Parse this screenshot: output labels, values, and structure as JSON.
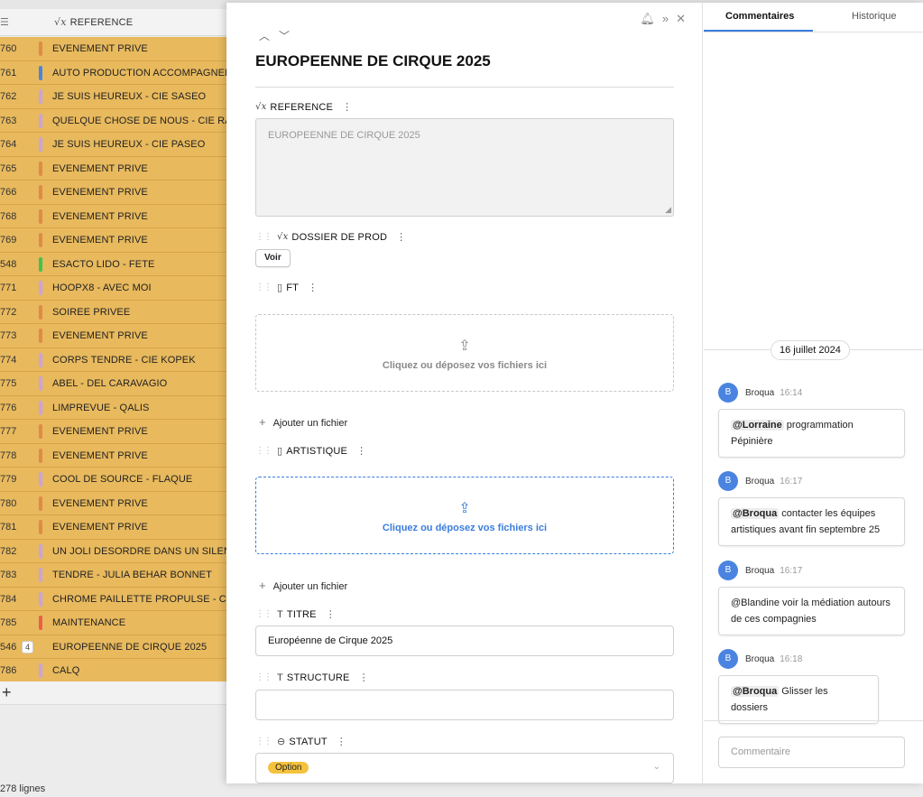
{
  "grid": {
    "header_label": "REFERENCE",
    "rows": [
      {
        "num": "760",
        "ref": "EVENEMENT PRIVE",
        "color": "#e08a4a"
      },
      {
        "num": "761",
        "ref": "AUTO PRODUCTION ACCOMPAGNEE",
        "color": "#4a84e0"
      },
      {
        "num": "762",
        "ref": "JE SUIS HEUREUX - CIE SASEO",
        "color": "#c9a3e0"
      },
      {
        "num": "763",
        "ref": "QUELQUE CHOSE DE NOUS - CIE RAMI",
        "color": "#c9a3e0"
      },
      {
        "num": "764",
        "ref": "JE SUIS HEUREUX - CIE PASEO",
        "color": "#c9a3e0"
      },
      {
        "num": "765",
        "ref": "EVENEMENT PRIVE",
        "color": "#e08a4a"
      },
      {
        "num": "766",
        "ref": "EVENEMENT PRIVE",
        "color": "#e08a4a"
      },
      {
        "num": "768",
        "ref": "EVENEMENT PRIVE",
        "color": "#e08a4a"
      },
      {
        "num": "769",
        "ref": "EVENEMENT PRIVE",
        "color": "#e08a4a"
      },
      {
        "num": "548",
        "ref": "ESACTO LIDO - FETE",
        "color": "#3cc452"
      },
      {
        "num": "771",
        "ref": "HOOPX8 - AVEC MOI",
        "color": "#c9a3e0"
      },
      {
        "num": "772",
        "ref": "SOIREE PRIVEE",
        "color": "#e08a4a"
      },
      {
        "num": "773",
        "ref": "EVENEMENT PRIVE",
        "color": "#e08a4a"
      },
      {
        "num": "774",
        "ref": "CORPS TENDRE - CIE KOPEK",
        "color": "#c9a3e0"
      },
      {
        "num": "775",
        "ref": "ABEL - DEL CARAVAGIO",
        "color": "#c9a3e0"
      },
      {
        "num": "776",
        "ref": "LIMPREVUE - QALIS",
        "color": "#c9a3e0"
      },
      {
        "num": "777",
        "ref": "EVENEMENT PRIVE",
        "color": "#e08a4a"
      },
      {
        "num": "778",
        "ref": "EVENEMENT PRIVE",
        "color": "#e08a4a"
      },
      {
        "num": "779",
        "ref": "COOL DE SOURCE - FLAQUE",
        "color": "#c9a3e0"
      },
      {
        "num": "780",
        "ref": "EVENEMENT PRIVE",
        "color": "#e08a4a"
      },
      {
        "num": "781",
        "ref": "EVENEMENT PRIVE",
        "color": "#e08a4a"
      },
      {
        "num": "782",
        "ref": "UN JOLI DESORDRE DANS UN SILENCE",
        "color": "#c9a3e0"
      },
      {
        "num": "783",
        "ref": "TENDRE - JULIA BEHAR BONNET",
        "color": "#c9a3e0"
      },
      {
        "num": "784",
        "ref": "CHROME PAILLETTE PROPULSE - CIRQ",
        "color": "#c9a3e0"
      },
      {
        "num": "785",
        "ref": "MAINTENANCE",
        "color": "#e8604a"
      },
      {
        "num": "546",
        "ref": "EUROPEENNE DE CIRQUE 2025",
        "color": "",
        "count": "4"
      },
      {
        "num": "786",
        "ref": "CALQ",
        "color": "#c9a3e0"
      }
    ],
    "footer": "278 lignes"
  },
  "detail": {
    "title": "EUROPEENNE DE CIRQUE 2025",
    "fields": {
      "reference": {
        "label": "REFERENCE",
        "value": "EUROPEENNE DE CIRQUE 2025"
      },
      "dossier": {
        "label": "DOSSIER DE PROD",
        "button": "Voir"
      },
      "ft": {
        "label": "FT",
        "dropzone": "Cliquez ou déposez vos fichiers ici",
        "add": "Ajouter un fichier"
      },
      "artistique": {
        "label": "ARTISTIQUE",
        "dropzone": "Cliquez ou déposez vos fichiers ici",
        "add": "Ajouter un fichier"
      },
      "titre": {
        "label": "TITRE",
        "value": "Européenne de Cirque 2025"
      },
      "structure": {
        "label": "STRUCTURE",
        "value": ""
      },
      "statut": {
        "label": "STATUT",
        "value": "Option"
      }
    }
  },
  "side": {
    "tabs": [
      "Commentaires",
      "Historique"
    ],
    "date": "16 juillet 2024",
    "comments": [
      {
        "initial": "B",
        "author": "Broqua",
        "time": "16:14",
        "mention": "@Lorraine",
        "text": " programmation Pépinière"
      },
      {
        "initial": "B",
        "author": "Broqua",
        "time": "16:17",
        "mention": "@Broqua",
        "text": " contacter les équipes artistiques avant fin septembre 25"
      },
      {
        "initial": "B",
        "author": "Broqua",
        "time": "16:17",
        "mention": "",
        "text": "@Blandine voir la médiation autours de ces compagnies"
      },
      {
        "initial": "B",
        "author": "Broqua",
        "time": "16:18",
        "mention": "@Broqua",
        "text": " Glisser les dossiers"
      }
    ],
    "comment_placeholder": "Commentaire"
  }
}
